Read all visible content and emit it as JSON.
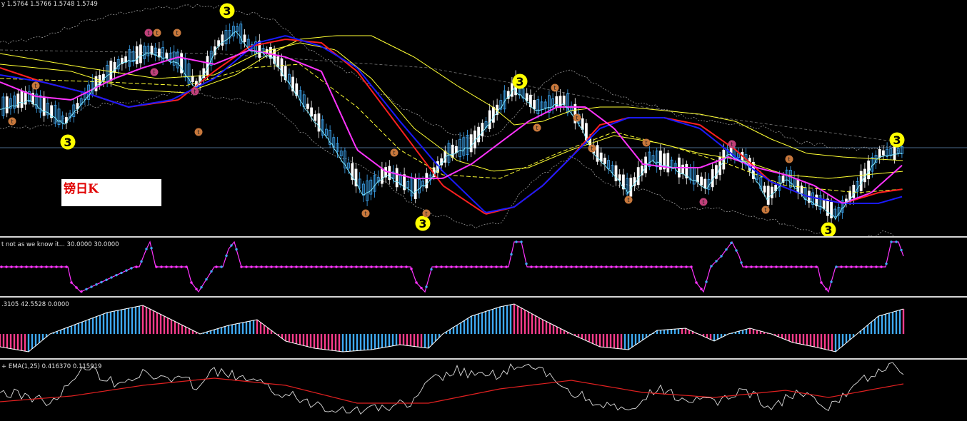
{
  "main_chart": {
    "price_readout": "y  1.5764 1.5766 1.5748 1.5749",
    "title_box": "镑日K",
    "wave_marker": "3",
    "small_marker": "t",
    "colors": {
      "bull_candle": "#3fa9f5",
      "bear_candle": "#ffffff",
      "red_ma": "#ff2020",
      "blue_ma": "#1a1aff",
      "magenta_ma": "#ff33ff",
      "yellow_ma": "#ffff33",
      "cyan_ma": "#7fe9ff",
      "envelope": "#9a9a9a",
      "marker_yellow": "#ffff00",
      "marker_orange": "#c8783c",
      "marker_pink": "#c0407a"
    }
  },
  "indicator_1": {
    "label": "t not as we know it...  30.0000 30.0000"
  },
  "indicator_2": {
    "label": ".3105 42.5528 0.0000"
  },
  "indicator_3": {
    "label": "+ EMA(1,25) 0.416370 0.115919"
  }
}
